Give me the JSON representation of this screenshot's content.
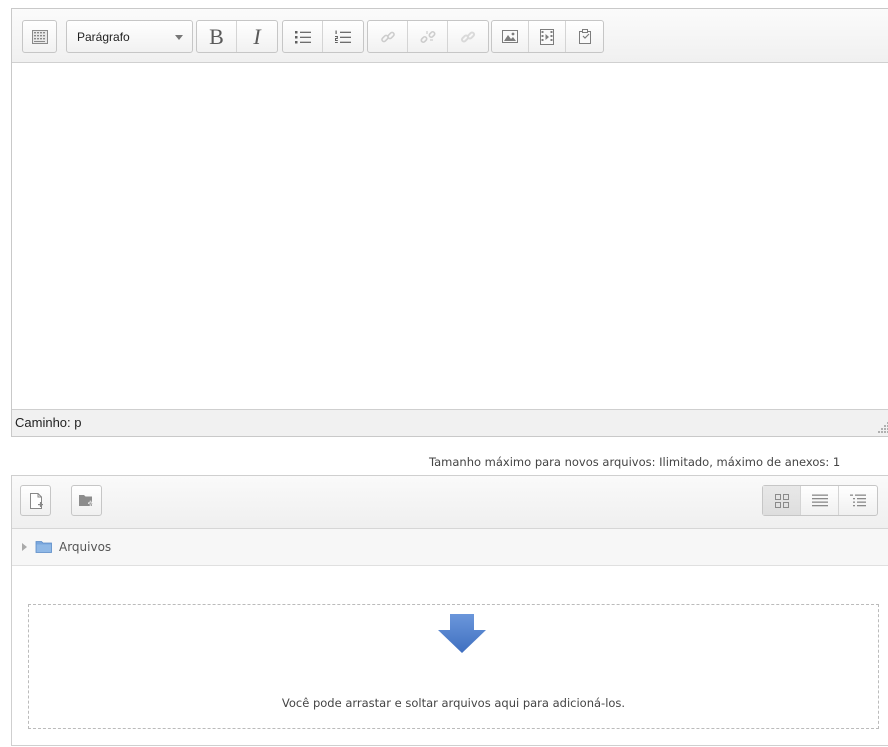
{
  "editor": {
    "format_select": {
      "value": "Parágrafo"
    },
    "toolbar": {
      "bold_glyph": "B",
      "italic_glyph": "I",
      "icons": [
        "toolbar-toggle-icon",
        "bold-icon",
        "italic-icon",
        "unordered-list-icon",
        "ordered-list-icon",
        "link-icon",
        "unlink-icon",
        "anchor-link-icon",
        "image-icon",
        "media-icon",
        "manage-files-icon"
      ]
    },
    "status_path": "Caminho: p"
  },
  "upload": {
    "max_size_text": "Tamanho máximo para novos arquivos: Ilimitado, máximo de anexos: 1"
  },
  "file_manager": {
    "toolbar_icons": [
      "add-file-icon",
      "create-folder-icon"
    ],
    "view_icons": [
      "view-icons-icon",
      "view-list-icon",
      "view-tree-icon"
    ],
    "path_folder": "Arquivos",
    "dropzone_message": "Você pode arrastar e soltar arquivos aqui para adicioná-los.",
    "colors": {
      "arrow": "#5a87cf",
      "folder": "#7aa7dd"
    }
  }
}
